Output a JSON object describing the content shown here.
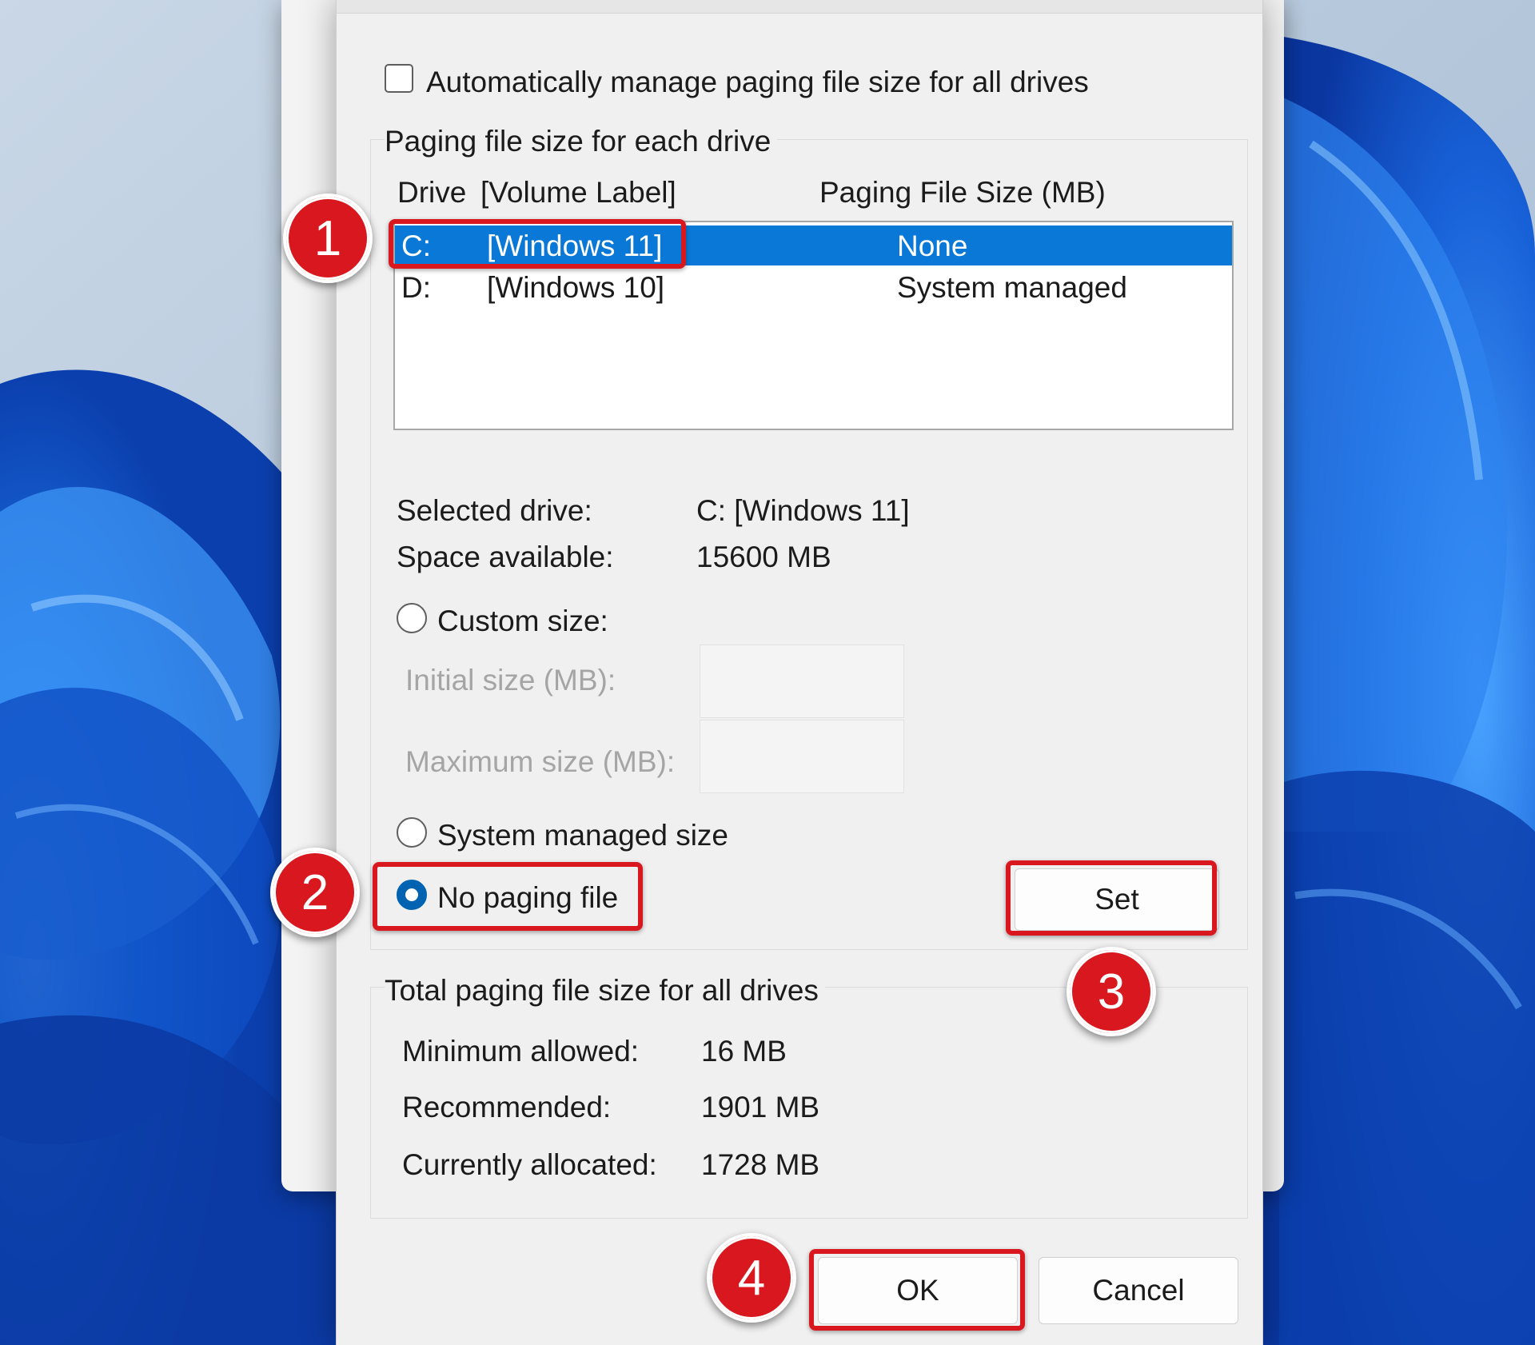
{
  "dialog": {
    "auto_manage_label": "Automatically manage paging file size for all drives",
    "auto_manage_checked": false,
    "group_each_drive": "Paging file size for each drive",
    "columns": {
      "drive": "Drive",
      "volume": "[Volume Label]",
      "size": "Paging File Size (MB)"
    },
    "drives": [
      {
        "letter": "C:",
        "label": "[Windows 11]",
        "size": "None",
        "selected": true
      },
      {
        "letter": "D:",
        "label": "[Windows 10]",
        "size": "System managed",
        "selected": false
      }
    ],
    "selected_drive_label": "Selected drive:",
    "selected_drive_value": "C:  [Windows 11]",
    "space_available_label": "Space available:",
    "space_available_value": "15600 MB",
    "custom_size_label": "Custom size:",
    "initial_size_label": "Initial size (MB):",
    "initial_size_value": "",
    "maximum_size_label": "Maximum size (MB):",
    "maximum_size_value": "",
    "system_managed_label": "System managed size",
    "no_paging_label": "No paging file",
    "selected_option": "no_paging",
    "set_button": "Set",
    "group_total": "Total paging file size for all drives",
    "minimum_allowed_label": "Minimum allowed:",
    "minimum_allowed_value": "16 MB",
    "recommended_label": "Recommended:",
    "recommended_value": "1901 MB",
    "currently_allocated_label": "Currently allocated:",
    "currently_allocated_value": "1728 MB",
    "ok_button": "OK",
    "cancel_button": "Cancel"
  },
  "annotations": [
    "1",
    "2",
    "3",
    "4"
  ],
  "colors": {
    "selection_blue": "#0a78d7",
    "radio_blue": "#0063b1",
    "highlight_red": "#d8181e",
    "wallpaper_blue": "#1560d6"
  }
}
